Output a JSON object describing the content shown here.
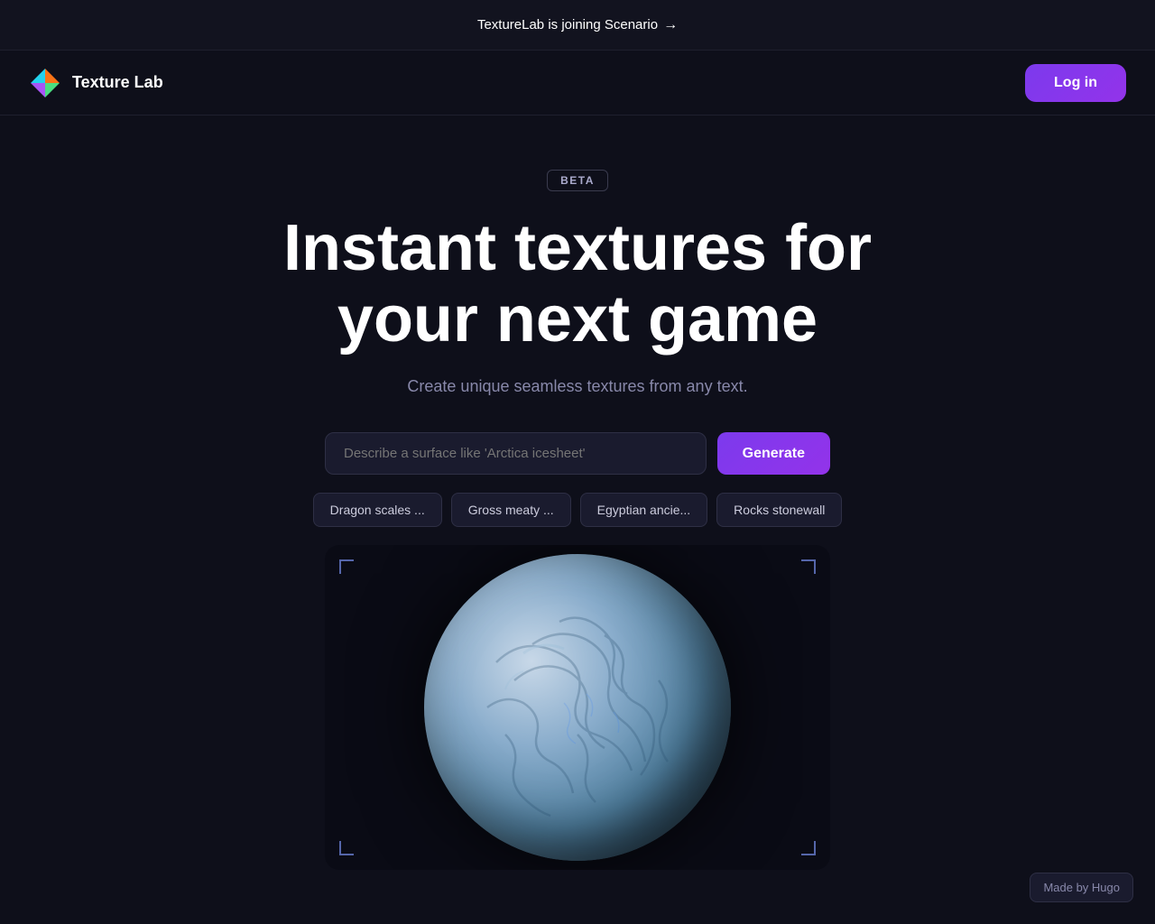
{
  "announcement": {
    "text": "TextureLab is joining Scenario",
    "arrow": "→"
  },
  "navbar": {
    "brand_name": "Texture Lab",
    "login_label": "Log in"
  },
  "hero": {
    "beta_label": "BETA",
    "title_line1": "Instant textures for",
    "title_line2": "your next game",
    "subtitle": "Create unique seamless textures from any text.",
    "search_placeholder": "Describe a surface like 'Arctica icesheet'",
    "generate_label": "Generate"
  },
  "chips": [
    {
      "label": "Dragon scales ..."
    },
    {
      "label": "Gross meaty ..."
    },
    {
      "label": "Egyptian ancie..."
    },
    {
      "label": "Rocks stonewall"
    }
  ],
  "footer": {
    "made_by": "Made by Hugo"
  }
}
